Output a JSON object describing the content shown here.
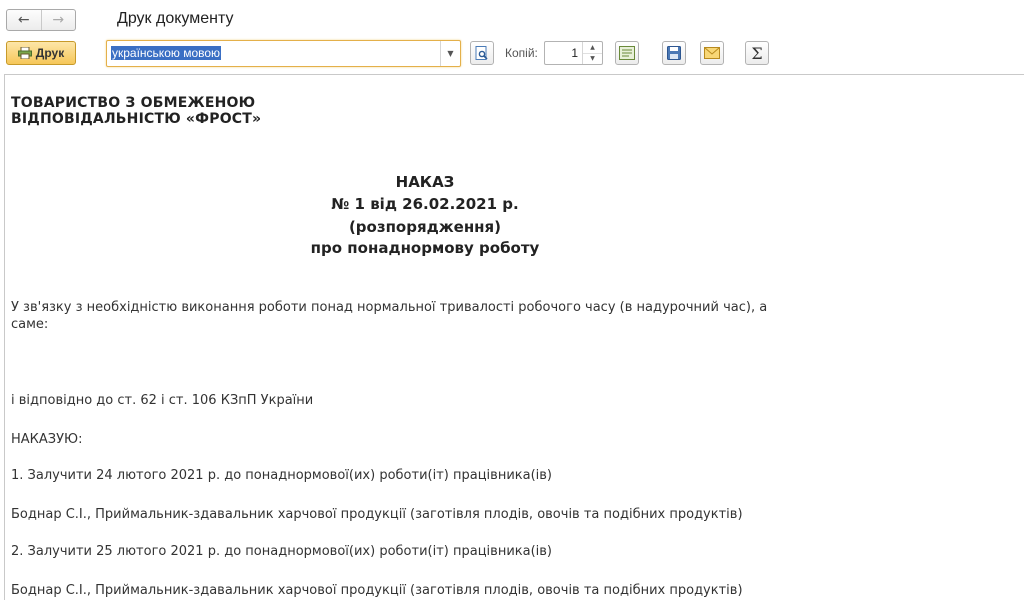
{
  "window": {
    "title": "Друк документу",
    "back_icon": "arrow-left-icon",
    "forward_icon": "arrow-right-icon"
  },
  "toolbar": {
    "print_label": "Друк",
    "language_value": "українською мовою",
    "copies_label": "Копій:",
    "copies_value": "1",
    "icons": [
      "preview-icon",
      "page-setup-icon",
      "save-icon",
      "email-icon",
      "sum-icon"
    ],
    "colors": {
      "accent": "#f6c759",
      "selection": "#3a6fc4"
    }
  },
  "document": {
    "org_line1": "ТОВАРИСТВО З ОБМЕЖЕНОЮ",
    "org_line2": "ВІДПОВІДАЛЬНІСТЮ «ФРОСТ»",
    "heading": "НАКАЗ",
    "number_line": "№ 1 від 26.02.2021 р.",
    "order_type": "(розпорядження)",
    "subject": "про понаднормову роботу",
    "intro_line1": "У зв'язку з необхідністю виконання роботи понад нормальної тривалості робочого часу (в надурочний час), а",
    "intro_line2": "саме:",
    "basis": "і відповідно до ст. 62 і ст. 106 КЗпП України",
    "order_word": "НАКАЗУЮ:",
    "item1": "1. Залучити 24 лютого 2021 р. до понаднормової(их) роботи(іт) працівника(ів)",
    "item1_employee": "Боднар С.І., Приймальник-здавальник харчової продукції (заготівля плодів, овочів та подібних продуктів)",
    "item2": "2. Залучити 25 лютого 2021 р. до понаднормової(их) роботи(іт) працівника(ів)",
    "item2_employee": "Боднар С.І., Приймальник-здавальник харчової продукції (заготівля плодів, овочів та подібних продуктів)"
  }
}
